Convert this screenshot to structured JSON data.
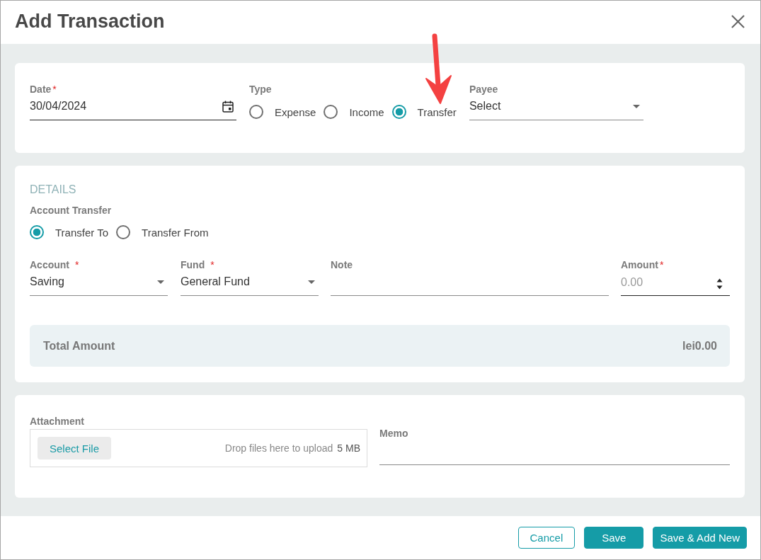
{
  "dialog": {
    "title": "Add Transaction"
  },
  "general": {
    "date": {
      "label": "Date",
      "required_mark": "*",
      "value": "30/04/2024"
    },
    "type": {
      "label": "Type",
      "options": [
        {
          "label": "Expense",
          "selected": false
        },
        {
          "label": "Income",
          "selected": false
        },
        {
          "label": "Transfer",
          "selected": true
        }
      ]
    },
    "payee": {
      "label": "Payee",
      "value": "Select"
    }
  },
  "details": {
    "heading": "DETAILS",
    "account_transfer": {
      "label": "Account Transfer",
      "options": [
        {
          "label": "Transfer To",
          "selected": true
        },
        {
          "label": "Transfer From",
          "selected": false
        }
      ]
    },
    "fields": [
      {
        "kind": "select",
        "label": "Account",
        "required_mark": "*",
        "value": "Saving"
      },
      {
        "kind": "select",
        "label": "Fund",
        "required_mark": "*",
        "value": "General Fund"
      },
      {
        "kind": "text",
        "label": "Note"
      },
      {
        "kind": "number",
        "label": "Amount",
        "required_mark": "*",
        "placeholder": "0.00"
      }
    ],
    "total": {
      "label": "Total Amount",
      "value": "lei0.00"
    }
  },
  "attachment": {
    "label": "Attachment",
    "button": "Select File",
    "hint": "Drop files here to upload",
    "size_limit": "5 MB"
  },
  "memo": {
    "label": "Memo"
  },
  "buttons": [
    {
      "label": "Cancel",
      "kind": "outline"
    },
    {
      "label": "Save",
      "kind": "primary"
    },
    {
      "label": "Save & Add New",
      "kind": "primary"
    }
  ]
}
